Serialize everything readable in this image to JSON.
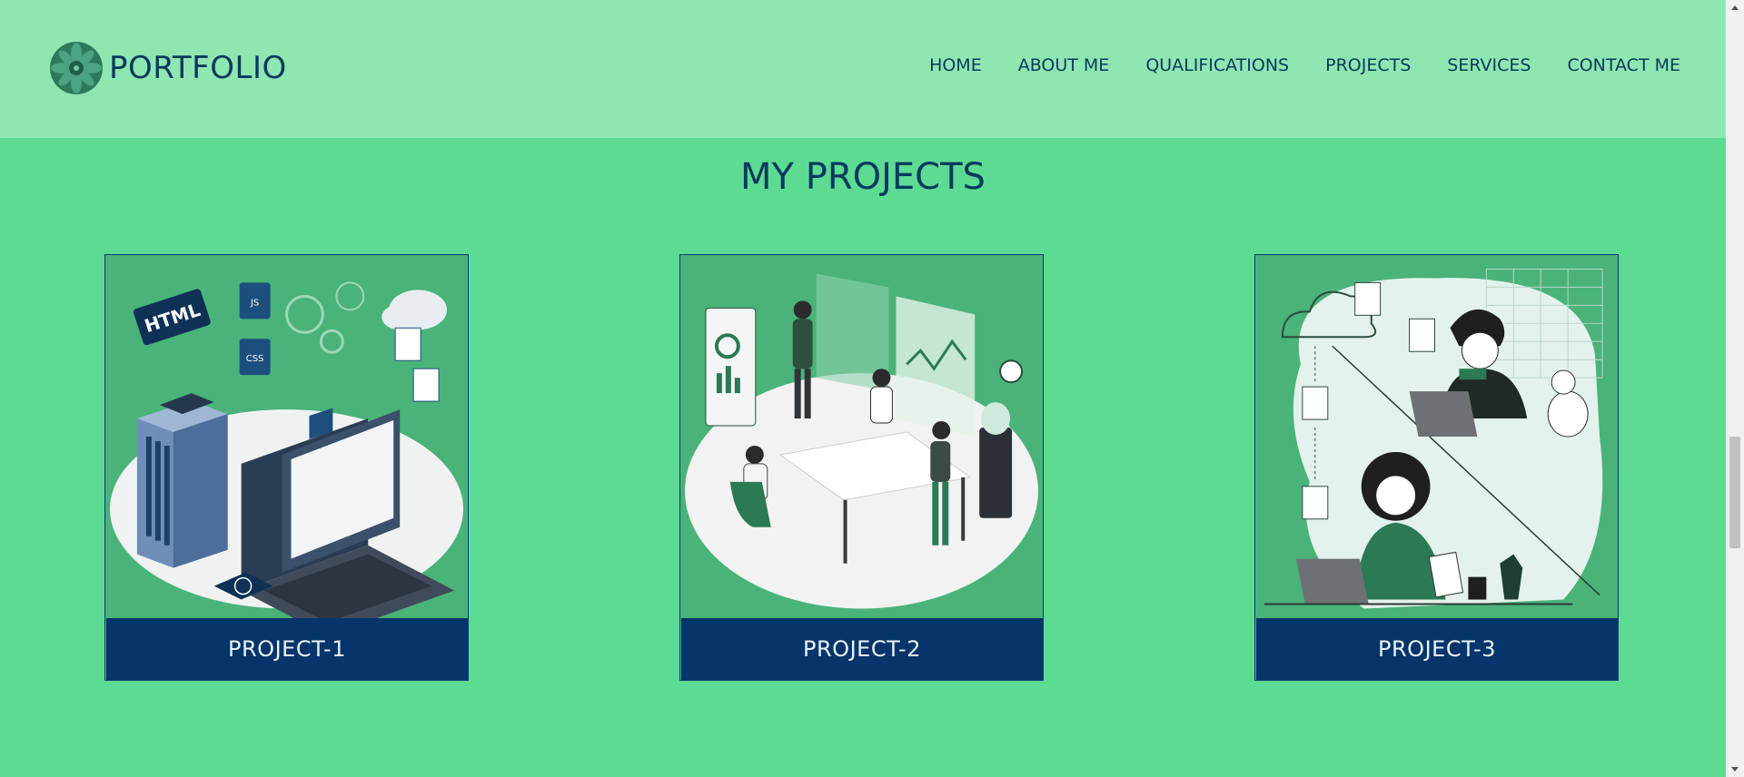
{
  "header": {
    "brand": "PORTFOLIO",
    "nav": [
      "HOME",
      "ABOUT ME",
      "QUALIFICATIONS",
      "PROJECTS",
      "SERVICES",
      "CONTACT ME"
    ]
  },
  "main": {
    "title": "MY PROJECTS",
    "projects": [
      {
        "label": "PROJECT-1",
        "image_icon": "web-development-illustration"
      },
      {
        "label": "PROJECT-2",
        "image_icon": "team-meeting-illustration"
      },
      {
        "label": "PROJECT-3",
        "image_icon": "remote-workers-illustration"
      }
    ]
  },
  "colors": {
    "page_bg": "#5ddb93",
    "header_bg": "#90e6b0",
    "text_primary": "#073a5e",
    "card_label_bg": "#05356a",
    "card_label_text": "#e9f2f8",
    "illustration_bg": "#4ab379"
  }
}
